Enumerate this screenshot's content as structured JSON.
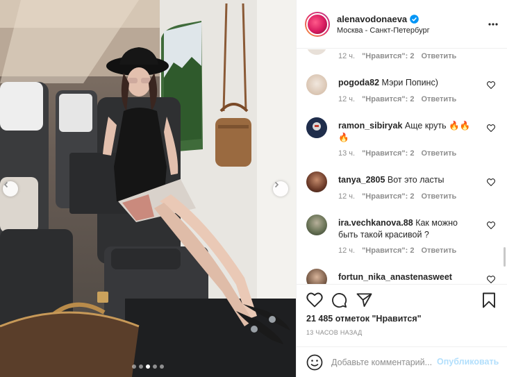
{
  "post": {
    "username": "alenavodonaeva",
    "location": "Москва - Санкт-Петербург",
    "likes_text": "21 485 отметок \"Нравится\"",
    "posted_text": "13 ЧАСОВ НАЗАД",
    "carousel": {
      "slides": 5,
      "active_index": 2
    }
  },
  "comments": [
    {
      "username": "",
      "text": "",
      "time": "12 ч.",
      "likes": "\"Нравится\": 2",
      "reply": "Ответить",
      "avatar_color": "#e8e0d8"
    },
    {
      "username": "pogoda82",
      "text": "Мэри Попинс)",
      "time": "12 ч.",
      "likes": "\"Нравится\": 2",
      "reply": "Ответить",
      "avatar_color": "#e9dfd7"
    },
    {
      "username": "ramon_sibiryak",
      "text": "Аще круть 🔥🔥🔥",
      "time": "13 ч.",
      "likes": "\"Нравится\": 2",
      "reply": "Ответить",
      "avatar_color": "#2c3e63"
    },
    {
      "username": "tanya_2805",
      "text": "Вот это ласты",
      "time": "12 ч.",
      "likes": "\"Нравится\": 2",
      "reply": "Ответить",
      "avatar_color": "#4b2a22"
    },
    {
      "username": "ira.vechkanova.88",
      "text": "Как можно быть такой красивой ?",
      "time": "12 ч.",
      "likes": "\"Нравится\": 2",
      "reply": "Ответить",
      "avatar_color": "#5d6a4e"
    },
    {
      "username": "fortun_nika_anastenasweet",
      "text": "",
      "time": "",
      "likes": "",
      "reply": "",
      "avatar_color": "#7a5c48"
    }
  ],
  "input": {
    "placeholder": "Добавьте комментарий...",
    "publish_label": "Опубликовать"
  },
  "icons": {
    "verified": "verified-badge-icon",
    "more": "more-options-icon",
    "like": "heart-icon",
    "comment": "comment-icon",
    "share": "share-icon",
    "save": "bookmark-icon",
    "emoji": "emoji-icon",
    "prev": "chevron-left-icon",
    "next": "chevron-right-icon"
  },
  "colors": {
    "verified_blue": "#0095f6",
    "publish_disabled": "#b2dffc",
    "secondary_text": "#8e8e8e"
  }
}
